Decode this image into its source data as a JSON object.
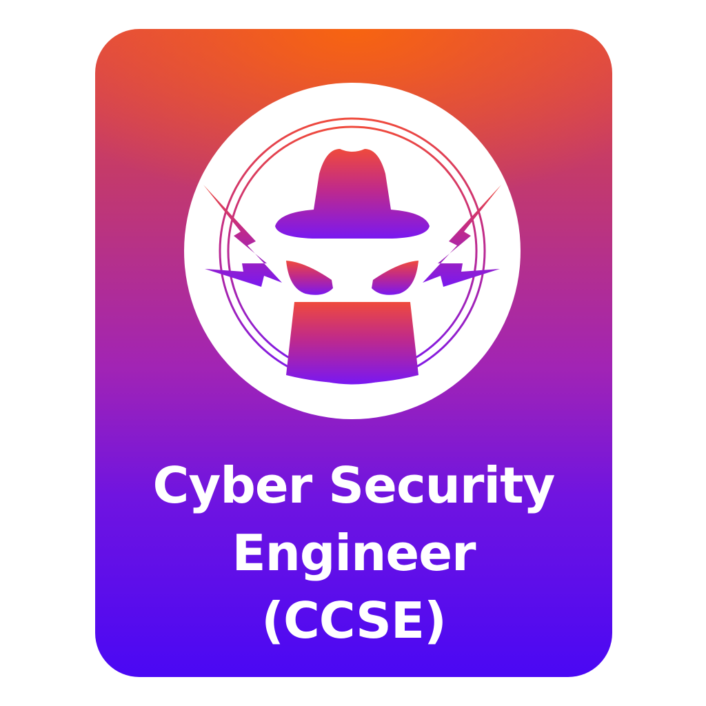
{
  "badge": {
    "title_lines": [
      "Cyber Security",
      "Engineer",
      "(CCSE)"
    ],
    "emblem_icon": "hacker-hat-icon",
    "colors": {
      "gradient_top": "#f76410",
      "gradient_mid": "#a224b4",
      "gradient_bottom": "#4a08f4",
      "emblem_fill_top": "#ef4a3c",
      "emblem_fill_bottom": "#7a18f0",
      "text": "#ffffff",
      "disc": "#ffffff"
    }
  }
}
